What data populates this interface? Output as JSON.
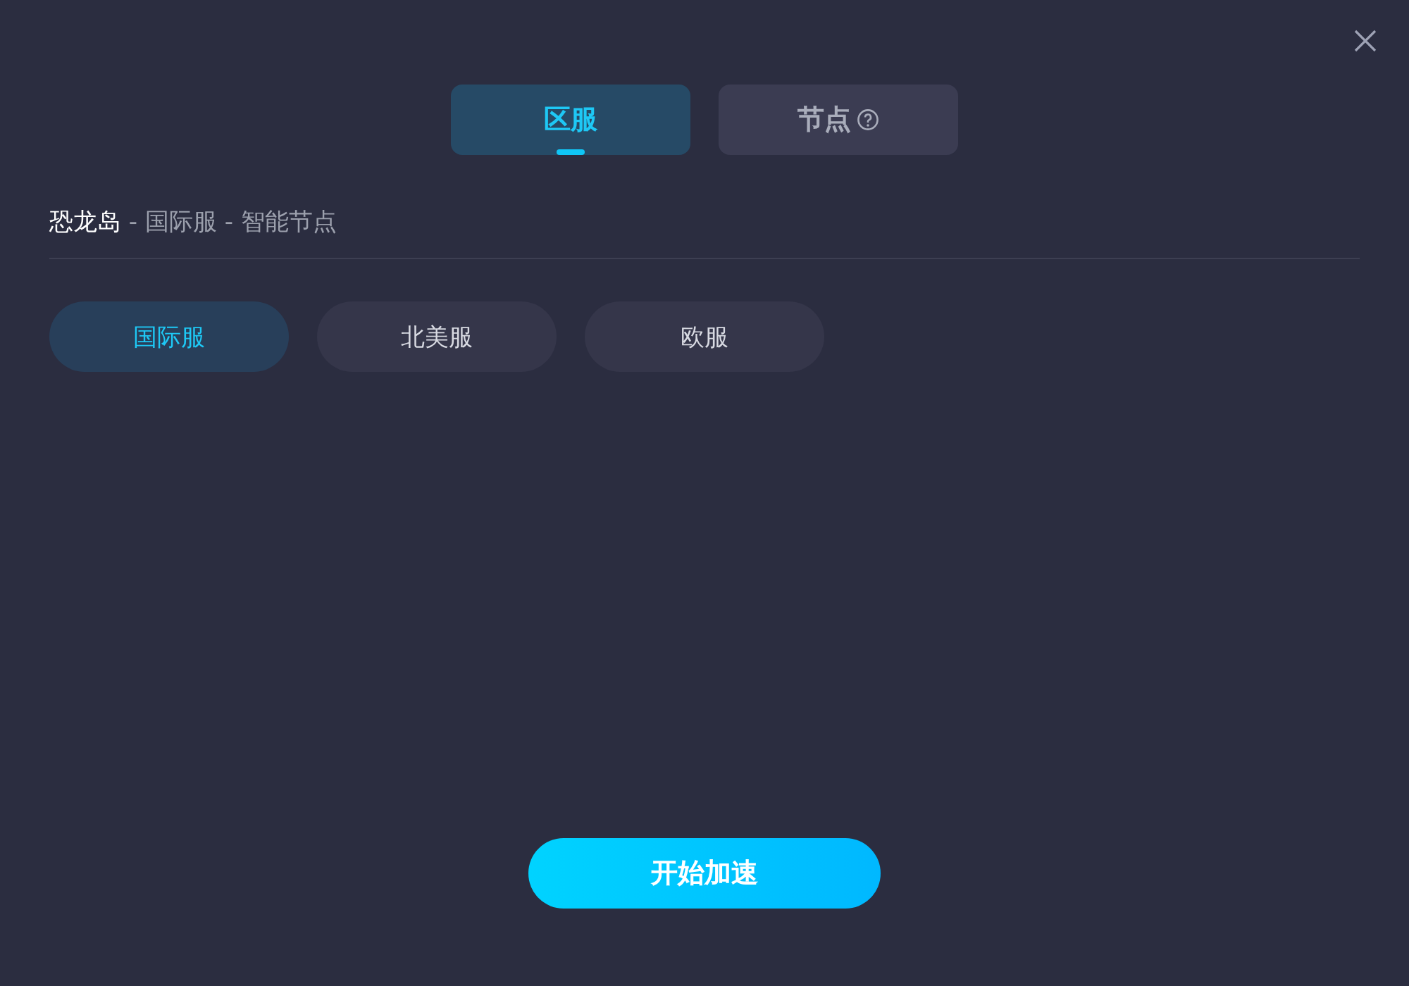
{
  "tabs": [
    {
      "label": "区服",
      "selected": true,
      "help": false
    },
    {
      "label": "节点",
      "selected": false,
      "help": true
    }
  ],
  "breadcrumb": {
    "game": "恐龙岛",
    "rest": "- 国际服 - 智能节点"
  },
  "regions": [
    {
      "label": "国际服",
      "selected": true
    },
    {
      "label": "北美服",
      "selected": false
    },
    {
      "label": "欧服",
      "selected": false
    }
  ],
  "start_button": "开始加速"
}
